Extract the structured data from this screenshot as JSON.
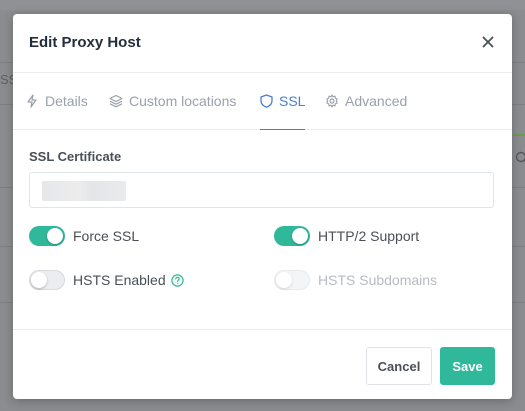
{
  "background": {
    "partial_tab_text": "SSL"
  },
  "modal": {
    "title": "Edit Proxy Host",
    "close_icon": "close-icon"
  },
  "tabs": [
    {
      "label": "Details",
      "icon": "bolt-icon",
      "active": false
    },
    {
      "label": "Custom locations",
      "icon": "layers-icon",
      "active": false
    },
    {
      "label": "SSL",
      "icon": "shield-icon",
      "active": true
    },
    {
      "label": "Advanced",
      "icon": "gear-icon",
      "active": false
    }
  ],
  "ssl": {
    "certificate_label": "SSL Certificate",
    "certificate_value_redacted": true,
    "options": [
      {
        "label": "Force SSL",
        "enabled": true,
        "disabled": false
      },
      {
        "label": "HTTP/2 Support",
        "enabled": true,
        "disabled": false
      },
      {
        "label": "HSTS Enabled",
        "enabled": false,
        "disabled": false,
        "help_icon": "question-circle-icon"
      },
      {
        "label": "HSTS Subdomains",
        "enabled": false,
        "disabled": true
      }
    ]
  },
  "footer": {
    "cancel_label": "Cancel",
    "save_label": "Save"
  },
  "colors": {
    "accent": "#2fb99a",
    "tab_active": "#467fcf",
    "text_muted": "#9aa0ac"
  }
}
